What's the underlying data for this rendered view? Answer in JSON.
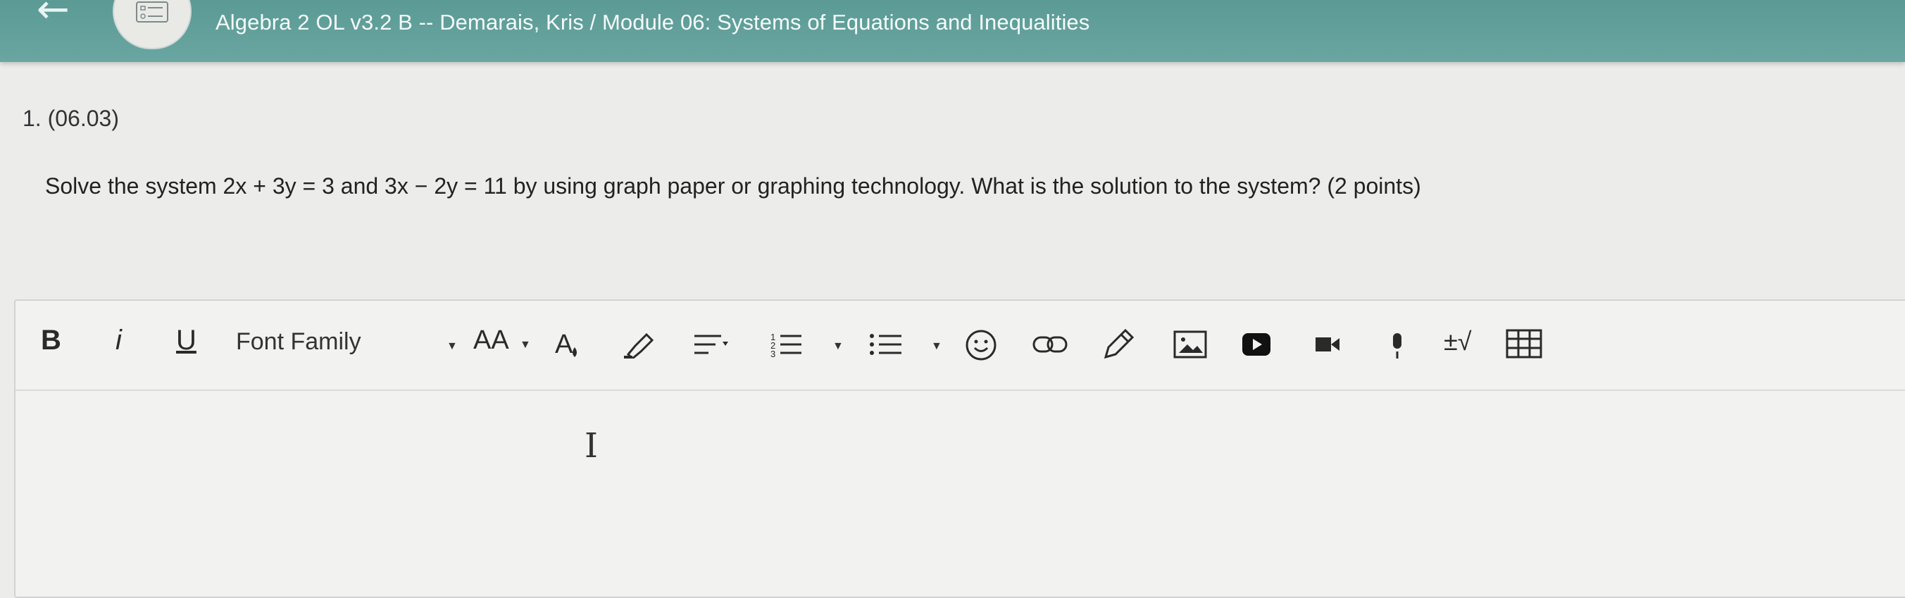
{
  "header": {
    "back_icon": "arrow-left-icon",
    "menu_icon": "checklist-icon",
    "title": "Algebra 2 OL v3.2 B -- Demarais, Kris / Module 06: Systems of Equations and Inequalities"
  },
  "question": {
    "number": "1. (06.03)",
    "prompt": "Solve the system 2x + 3y = 3 and 3x − 2y = 11 by using graph paper or graphing technology. What is the solution to the system? (2 points)"
  },
  "toolbar": {
    "bold": "B",
    "italic": "i",
    "underline": "U",
    "font_family": "Font Family",
    "font_size": "AA",
    "math": "±√"
  },
  "editor": {
    "value": ""
  }
}
